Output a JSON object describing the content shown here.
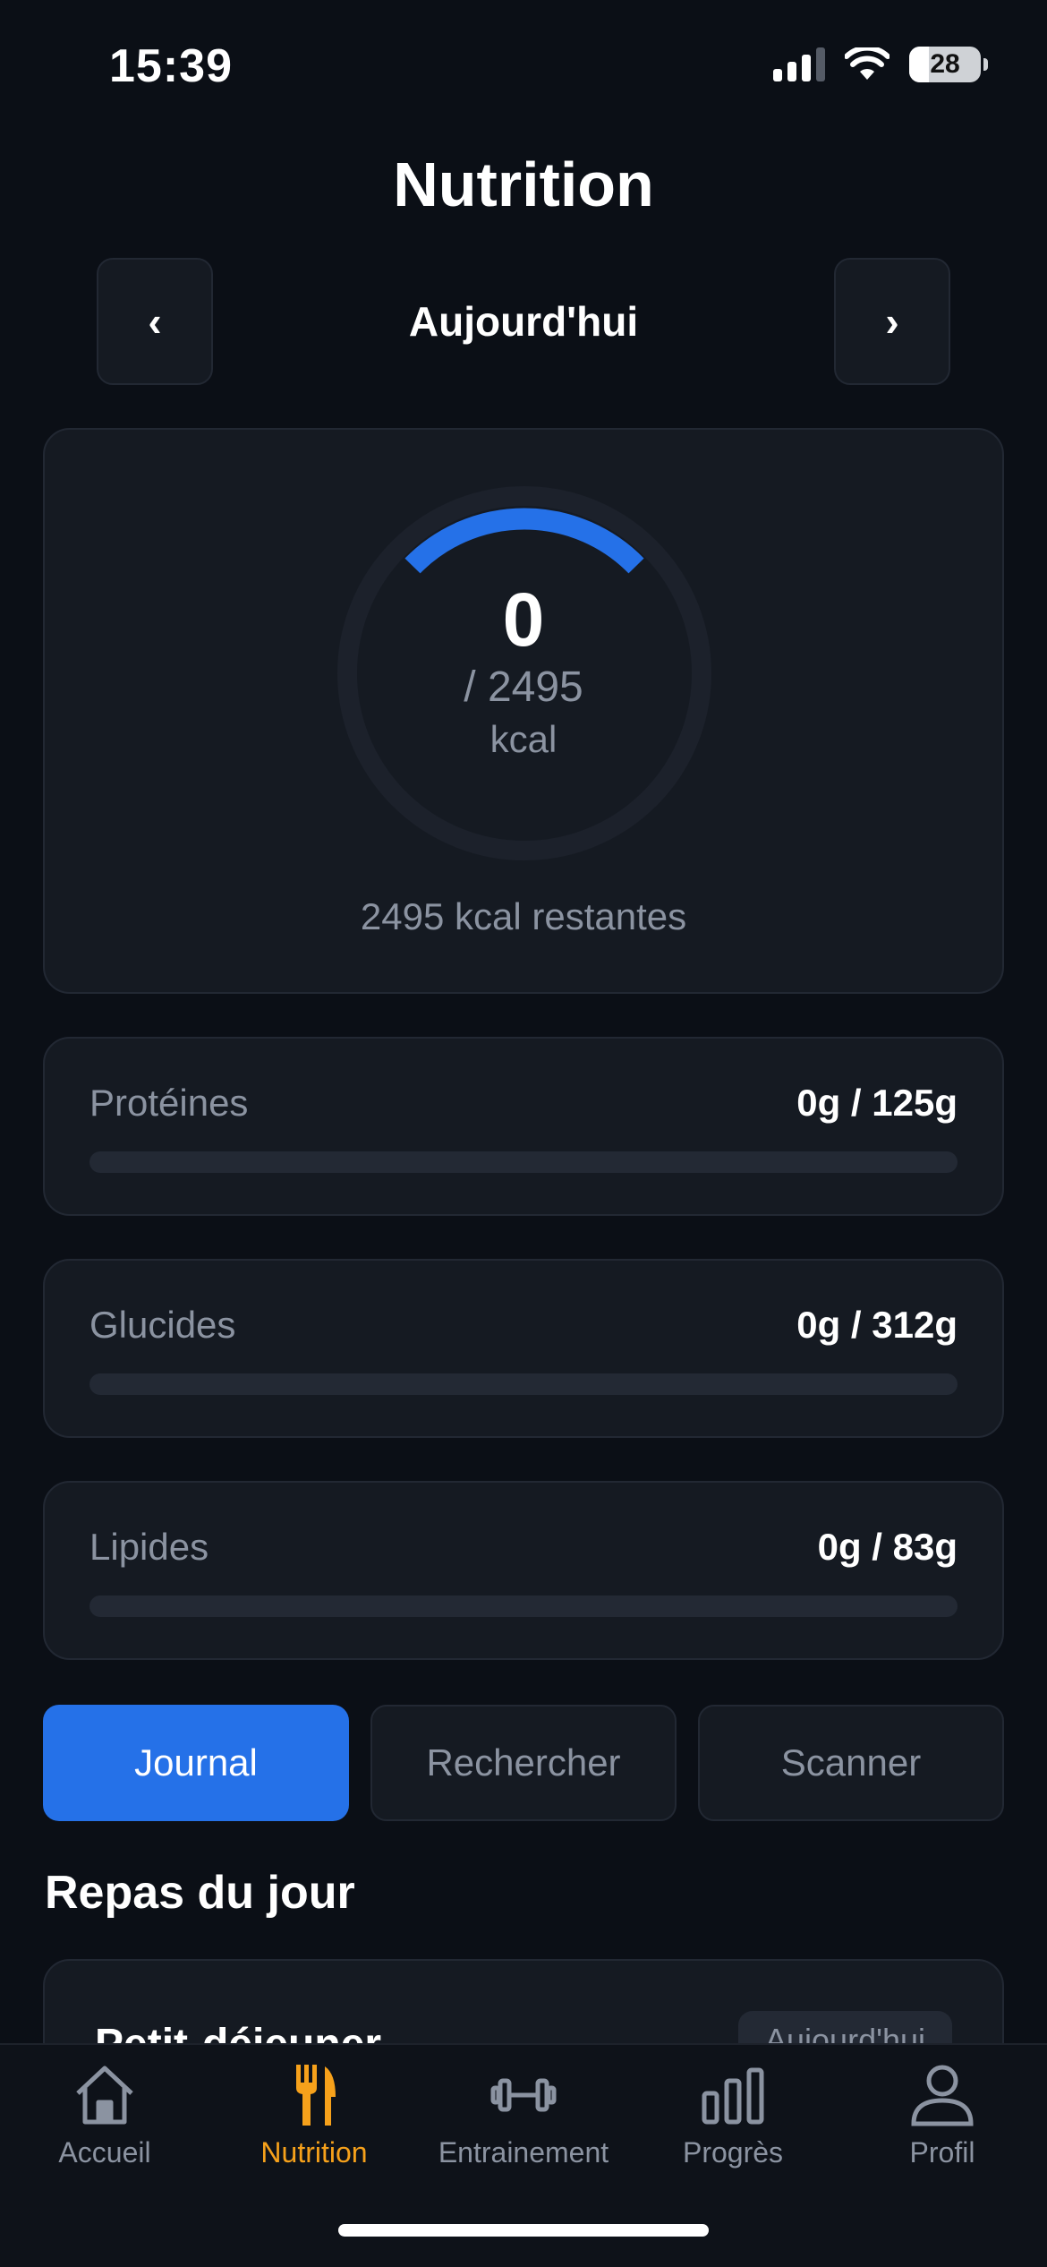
{
  "status_bar": {
    "time": "15:39",
    "battery": "28",
    "battery_level": 0.28
  },
  "header": {
    "title": "Nutrition",
    "date_label": "Aujourd'hui",
    "prev_symbol": "‹",
    "next_symbol": "›"
  },
  "calories": {
    "consumed": "0",
    "target": "/ 2495",
    "unit": "kcal",
    "remaining": "2495 kcal restantes"
  },
  "macros": [
    {
      "label": "Protéines",
      "value": "0g / 125g",
      "progress": 0
    },
    {
      "label": "Glucides",
      "value": "0g / 312g",
      "progress": 0
    },
    {
      "label": "Lipides",
      "value": "0g / 83g",
      "progress": 0
    }
  ],
  "tabs": [
    {
      "label": "Journal",
      "active": true
    },
    {
      "label": "Rechercher",
      "active": false
    },
    {
      "label": "Scanner",
      "active": false
    }
  ],
  "meals_section": {
    "title": "Repas du jour",
    "first_meal": {
      "title": "Petit-déjeuner",
      "badge": "Aujourd'hui"
    }
  },
  "tabbar": [
    {
      "label": "Accueil",
      "icon": "home-icon",
      "active": false
    },
    {
      "label": "Nutrition",
      "icon": "fork-knife-icon",
      "active": true
    },
    {
      "label": "Entrainement",
      "icon": "dumbbell-icon",
      "active": false
    },
    {
      "label": "Progrès",
      "icon": "bar-chart-icon",
      "active": false
    },
    {
      "label": "Profil",
      "icon": "person-icon",
      "active": false
    }
  ],
  "colors": {
    "accent_blue": "#2571e8",
    "active_tab_orange": "#f6a11b",
    "background": "#0b0f16",
    "card": "#151a22",
    "muted_text": "#8b93a1"
  }
}
